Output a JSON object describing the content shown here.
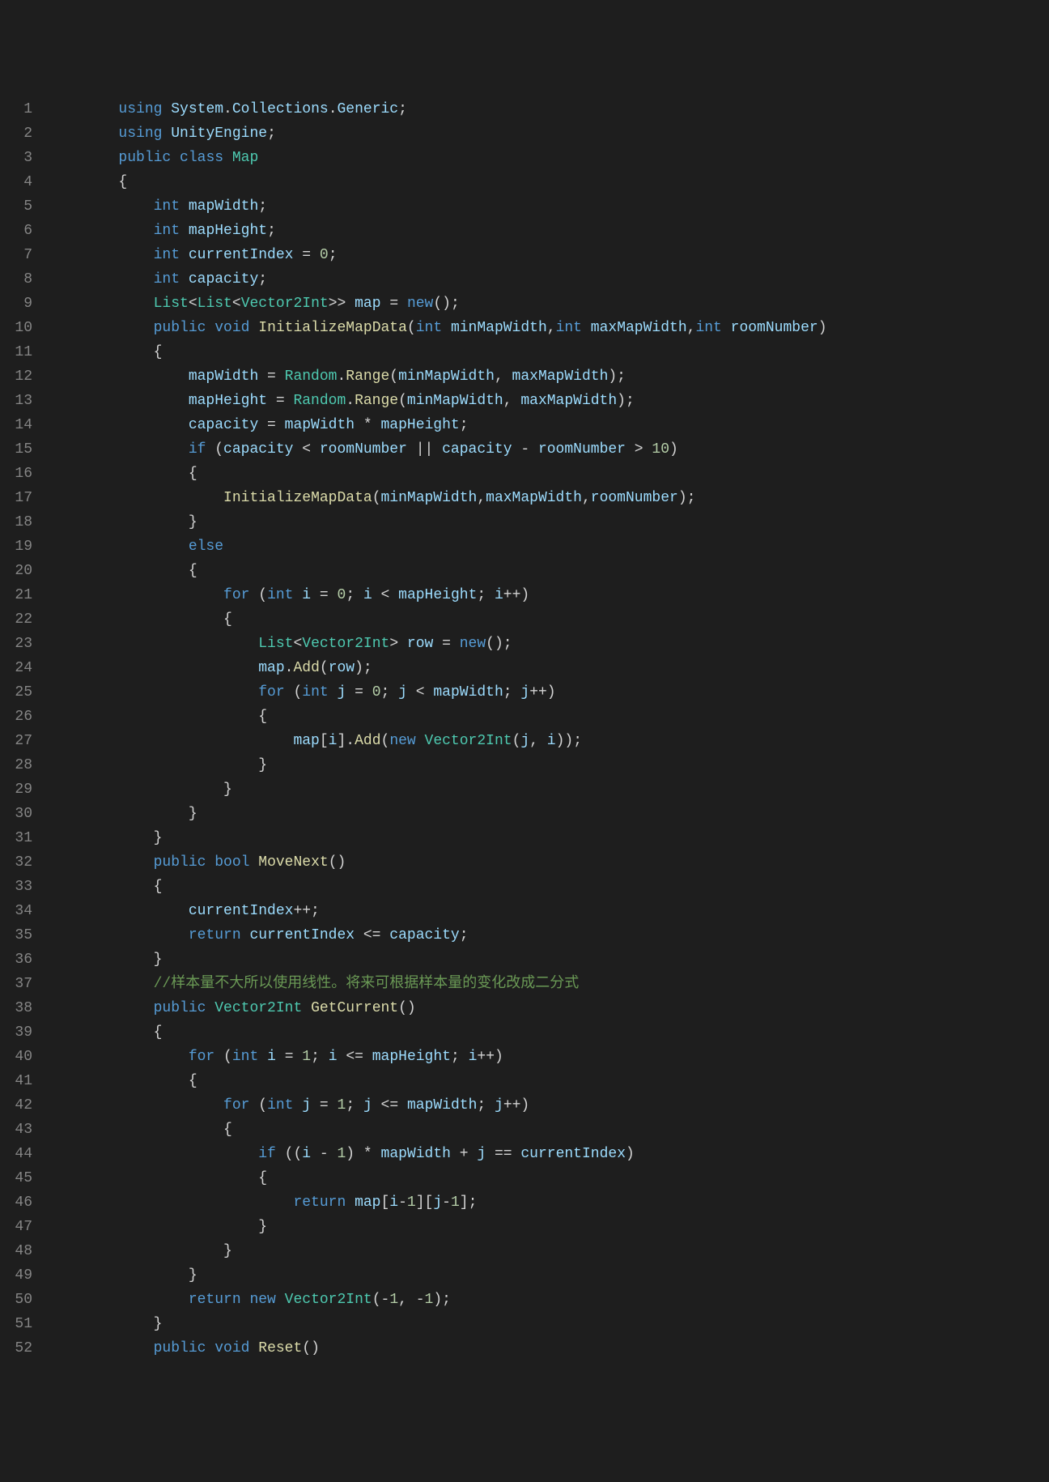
{
  "lines": [
    {
      "n": "1",
      "indent": 2,
      "tokens": [
        {
          "t": "using ",
          "c": "kw"
        },
        {
          "t": "System",
          "c": "var"
        },
        {
          "t": ".",
          "c": "op"
        },
        {
          "t": "Collections",
          "c": "var"
        },
        {
          "t": ".",
          "c": "op"
        },
        {
          "t": "Generic",
          "c": "var"
        },
        {
          "t": ";",
          "c": "op"
        }
      ]
    },
    {
      "n": "2",
      "indent": 2,
      "tokens": [
        {
          "t": "using ",
          "c": "kw"
        },
        {
          "t": "UnityEngine",
          "c": "var"
        },
        {
          "t": ";",
          "c": "op"
        }
      ]
    },
    {
      "n": "3",
      "indent": 2,
      "tokens": [
        {
          "t": "public ",
          "c": "kw"
        },
        {
          "t": "class ",
          "c": "kw"
        },
        {
          "t": "Map",
          "c": "type"
        }
      ]
    },
    {
      "n": "4",
      "indent": 2,
      "tokens": [
        {
          "t": "{",
          "c": "brace"
        }
      ]
    },
    {
      "n": "5",
      "indent": 3,
      "tokens": [
        {
          "t": "int ",
          "c": "kw"
        },
        {
          "t": "mapWidth",
          "c": "var"
        },
        {
          "t": ";",
          "c": "op"
        }
      ]
    },
    {
      "n": "6",
      "indent": 3,
      "tokens": [
        {
          "t": "int ",
          "c": "kw"
        },
        {
          "t": "mapHeight",
          "c": "var"
        },
        {
          "t": ";",
          "c": "op"
        }
      ]
    },
    {
      "n": "7",
      "indent": 3,
      "tokens": [
        {
          "t": "int ",
          "c": "kw"
        },
        {
          "t": "currentIndex",
          "c": "var"
        },
        {
          "t": " = ",
          "c": "op"
        },
        {
          "t": "0",
          "c": "num"
        },
        {
          "t": ";",
          "c": "op"
        }
      ]
    },
    {
      "n": "8",
      "indent": 3,
      "tokens": [
        {
          "t": "int ",
          "c": "kw"
        },
        {
          "t": "capacity",
          "c": "var"
        },
        {
          "t": ";",
          "c": "op"
        }
      ]
    },
    {
      "n": "9",
      "indent": 3,
      "tokens": [
        {
          "t": "List",
          "c": "type"
        },
        {
          "t": "<",
          "c": "op"
        },
        {
          "t": "List",
          "c": "type"
        },
        {
          "t": "<",
          "c": "op"
        },
        {
          "t": "Vector2Int",
          "c": "type"
        },
        {
          "t": ">> ",
          "c": "op"
        },
        {
          "t": "map",
          "c": "var"
        },
        {
          "t": " = ",
          "c": "op"
        },
        {
          "t": "new",
          "c": "kw"
        },
        {
          "t": "();",
          "c": "op"
        }
      ]
    },
    {
      "n": "10",
      "indent": 3,
      "tokens": [
        {
          "t": "public ",
          "c": "kw"
        },
        {
          "t": "void ",
          "c": "kw"
        },
        {
          "t": "InitializeMapData",
          "c": "method"
        },
        {
          "t": "(",
          "c": "op"
        },
        {
          "t": "int ",
          "c": "kw"
        },
        {
          "t": "minMapWidth",
          "c": "var"
        },
        {
          "t": ",",
          "c": "op"
        },
        {
          "t": "int ",
          "c": "kw"
        },
        {
          "t": "maxMapWidth",
          "c": "var"
        },
        {
          "t": ",",
          "c": "op"
        },
        {
          "t": "int ",
          "c": "kw"
        },
        {
          "t": "roomNumber",
          "c": "var"
        },
        {
          "t": ")",
          "c": "op"
        }
      ]
    },
    {
      "n": "11",
      "indent": 3,
      "tokens": [
        {
          "t": "{",
          "c": "brace"
        }
      ]
    },
    {
      "n": "12",
      "indent": 4,
      "tokens": [
        {
          "t": "mapWidth",
          "c": "var"
        },
        {
          "t": " = ",
          "c": "op"
        },
        {
          "t": "Random",
          "c": "type"
        },
        {
          "t": ".",
          "c": "op"
        },
        {
          "t": "Range",
          "c": "method"
        },
        {
          "t": "(",
          "c": "op"
        },
        {
          "t": "minMapWidth",
          "c": "var"
        },
        {
          "t": ", ",
          "c": "op"
        },
        {
          "t": "maxMapWidth",
          "c": "var"
        },
        {
          "t": ");",
          "c": "op"
        }
      ]
    },
    {
      "n": "13",
      "indent": 4,
      "tokens": [
        {
          "t": "mapHeight",
          "c": "var"
        },
        {
          "t": " = ",
          "c": "op"
        },
        {
          "t": "Random",
          "c": "type"
        },
        {
          "t": ".",
          "c": "op"
        },
        {
          "t": "Range",
          "c": "method"
        },
        {
          "t": "(",
          "c": "op"
        },
        {
          "t": "minMapWidth",
          "c": "var"
        },
        {
          "t": ", ",
          "c": "op"
        },
        {
          "t": "maxMapWidth",
          "c": "var"
        },
        {
          "t": ");",
          "c": "op"
        }
      ]
    },
    {
      "n": "14",
      "indent": 4,
      "tokens": [
        {
          "t": "capacity",
          "c": "var"
        },
        {
          "t": " = ",
          "c": "op"
        },
        {
          "t": "mapWidth",
          "c": "var"
        },
        {
          "t": " * ",
          "c": "op"
        },
        {
          "t": "mapHeight",
          "c": "var"
        },
        {
          "t": ";",
          "c": "op"
        }
      ]
    },
    {
      "n": "15",
      "indent": 4,
      "tokens": [
        {
          "t": "if ",
          "c": "kw"
        },
        {
          "t": "(",
          "c": "op"
        },
        {
          "t": "capacity",
          "c": "var"
        },
        {
          "t": " < ",
          "c": "op"
        },
        {
          "t": "roomNumber",
          "c": "var"
        },
        {
          "t": " || ",
          "c": "op"
        },
        {
          "t": "capacity",
          "c": "var"
        },
        {
          "t": " - ",
          "c": "op"
        },
        {
          "t": "roomNumber",
          "c": "var"
        },
        {
          "t": " > ",
          "c": "op"
        },
        {
          "t": "10",
          "c": "num"
        },
        {
          "t": ")",
          "c": "op"
        }
      ]
    },
    {
      "n": "16",
      "indent": 4,
      "tokens": [
        {
          "t": "{",
          "c": "brace"
        }
      ]
    },
    {
      "n": "17",
      "indent": 5,
      "tokens": [
        {
          "t": "InitializeMapData",
          "c": "method"
        },
        {
          "t": "(",
          "c": "op"
        },
        {
          "t": "minMapWidth",
          "c": "var"
        },
        {
          "t": ",",
          "c": "op"
        },
        {
          "t": "maxMapWidth",
          "c": "var"
        },
        {
          "t": ",",
          "c": "op"
        },
        {
          "t": "roomNumber",
          "c": "var"
        },
        {
          "t": ");",
          "c": "op"
        }
      ]
    },
    {
      "n": "18",
      "indent": 4,
      "tokens": [
        {
          "t": "}",
          "c": "brace"
        }
      ]
    },
    {
      "n": "19",
      "indent": 4,
      "tokens": [
        {
          "t": "else",
          "c": "kw"
        }
      ]
    },
    {
      "n": "20",
      "indent": 4,
      "tokens": [
        {
          "t": "{",
          "c": "brace"
        }
      ]
    },
    {
      "n": "21",
      "indent": 5,
      "tokens": [
        {
          "t": "for ",
          "c": "kw"
        },
        {
          "t": "(",
          "c": "op"
        },
        {
          "t": "int ",
          "c": "kw"
        },
        {
          "t": "i",
          "c": "var"
        },
        {
          "t": " = ",
          "c": "op"
        },
        {
          "t": "0",
          "c": "num"
        },
        {
          "t": "; ",
          "c": "op"
        },
        {
          "t": "i",
          "c": "var"
        },
        {
          "t": " < ",
          "c": "op"
        },
        {
          "t": "mapHeight",
          "c": "var"
        },
        {
          "t": "; ",
          "c": "op"
        },
        {
          "t": "i",
          "c": "var"
        },
        {
          "t": "++)",
          "c": "op"
        }
      ]
    },
    {
      "n": "22",
      "indent": 5,
      "tokens": [
        {
          "t": "{",
          "c": "brace"
        }
      ]
    },
    {
      "n": "23",
      "indent": 6,
      "tokens": [
        {
          "t": "List",
          "c": "type"
        },
        {
          "t": "<",
          "c": "op"
        },
        {
          "t": "Vector2Int",
          "c": "type"
        },
        {
          "t": "> ",
          "c": "op"
        },
        {
          "t": "row",
          "c": "var"
        },
        {
          "t": " = ",
          "c": "op"
        },
        {
          "t": "new",
          "c": "kw"
        },
        {
          "t": "();",
          "c": "op"
        }
      ]
    },
    {
      "n": "24",
      "indent": 6,
      "tokens": [
        {
          "t": "map",
          "c": "var"
        },
        {
          "t": ".",
          "c": "op"
        },
        {
          "t": "Add",
          "c": "method"
        },
        {
          "t": "(",
          "c": "op"
        },
        {
          "t": "row",
          "c": "var"
        },
        {
          "t": ");",
          "c": "op"
        }
      ]
    },
    {
      "n": "25",
      "indent": 6,
      "tokens": [
        {
          "t": "for ",
          "c": "kw"
        },
        {
          "t": "(",
          "c": "op"
        },
        {
          "t": "int ",
          "c": "kw"
        },
        {
          "t": "j",
          "c": "var"
        },
        {
          "t": " = ",
          "c": "op"
        },
        {
          "t": "0",
          "c": "num"
        },
        {
          "t": "; ",
          "c": "op"
        },
        {
          "t": "j",
          "c": "var"
        },
        {
          "t": " < ",
          "c": "op"
        },
        {
          "t": "mapWidth",
          "c": "var"
        },
        {
          "t": "; ",
          "c": "op"
        },
        {
          "t": "j",
          "c": "var"
        },
        {
          "t": "++)",
          "c": "op"
        }
      ]
    },
    {
      "n": "26",
      "indent": 6,
      "tokens": [
        {
          "t": "{",
          "c": "brace"
        }
      ]
    },
    {
      "n": "27",
      "indent": 7,
      "tokens": [
        {
          "t": "map",
          "c": "var"
        },
        {
          "t": "[",
          "c": "op"
        },
        {
          "t": "i",
          "c": "var"
        },
        {
          "t": "].",
          "c": "op"
        },
        {
          "t": "Add",
          "c": "method"
        },
        {
          "t": "(",
          "c": "op"
        },
        {
          "t": "new ",
          "c": "kw"
        },
        {
          "t": "Vector2Int",
          "c": "type"
        },
        {
          "t": "(",
          "c": "op"
        },
        {
          "t": "j",
          "c": "var"
        },
        {
          "t": ", ",
          "c": "op"
        },
        {
          "t": "i",
          "c": "var"
        },
        {
          "t": "));",
          "c": "op"
        }
      ]
    },
    {
      "n": "28",
      "indent": 6,
      "tokens": [
        {
          "t": "}",
          "c": "brace"
        }
      ]
    },
    {
      "n": "29",
      "indent": 5,
      "tokens": [
        {
          "t": "}",
          "c": "brace"
        }
      ]
    },
    {
      "n": "30",
      "indent": 4,
      "tokens": [
        {
          "t": "}",
          "c": "brace"
        }
      ]
    },
    {
      "n": "31",
      "indent": 3,
      "tokens": [
        {
          "t": "}",
          "c": "brace"
        }
      ]
    },
    {
      "n": "32",
      "indent": 3,
      "tokens": [
        {
          "t": "public ",
          "c": "kw"
        },
        {
          "t": "bool ",
          "c": "kw"
        },
        {
          "t": "MoveNext",
          "c": "method"
        },
        {
          "t": "()",
          "c": "op"
        }
      ]
    },
    {
      "n": "33",
      "indent": 3,
      "tokens": [
        {
          "t": "{",
          "c": "brace"
        }
      ]
    },
    {
      "n": "34",
      "indent": 4,
      "tokens": [
        {
          "t": "currentIndex",
          "c": "var"
        },
        {
          "t": "++;",
          "c": "op"
        }
      ]
    },
    {
      "n": "35",
      "indent": 4,
      "tokens": [
        {
          "t": "return ",
          "c": "kw"
        },
        {
          "t": "currentIndex",
          "c": "var"
        },
        {
          "t": " <= ",
          "c": "op"
        },
        {
          "t": "capacity",
          "c": "var"
        },
        {
          "t": ";",
          "c": "op"
        }
      ]
    },
    {
      "n": "36",
      "indent": 3,
      "tokens": [
        {
          "t": "}",
          "c": "brace"
        }
      ]
    },
    {
      "n": "37",
      "indent": 3,
      "tokens": [
        {
          "t": "//样本量不大所以使用线性。将来可根据样本量的变化改成二分式",
          "c": "comment"
        }
      ]
    },
    {
      "n": "38",
      "indent": 3,
      "tokens": [
        {
          "t": "public ",
          "c": "kw"
        },
        {
          "t": "Vector2Int ",
          "c": "type"
        },
        {
          "t": "GetCurrent",
          "c": "method"
        },
        {
          "t": "()",
          "c": "op"
        }
      ]
    },
    {
      "n": "39",
      "indent": 3,
      "tokens": [
        {
          "t": "{",
          "c": "brace"
        }
      ]
    },
    {
      "n": "40",
      "indent": 4,
      "tokens": [
        {
          "t": "for ",
          "c": "kw"
        },
        {
          "t": "(",
          "c": "op"
        },
        {
          "t": "int ",
          "c": "kw"
        },
        {
          "t": "i",
          "c": "var"
        },
        {
          "t": " = ",
          "c": "op"
        },
        {
          "t": "1",
          "c": "num"
        },
        {
          "t": "; ",
          "c": "op"
        },
        {
          "t": "i",
          "c": "var"
        },
        {
          "t": " <= ",
          "c": "op"
        },
        {
          "t": "mapHeight",
          "c": "var"
        },
        {
          "t": "; ",
          "c": "op"
        },
        {
          "t": "i",
          "c": "var"
        },
        {
          "t": "++)",
          "c": "op"
        }
      ]
    },
    {
      "n": "41",
      "indent": 4,
      "tokens": [
        {
          "t": "{",
          "c": "brace"
        }
      ]
    },
    {
      "n": "42",
      "indent": 5,
      "tokens": [
        {
          "t": "for ",
          "c": "kw"
        },
        {
          "t": "(",
          "c": "op"
        },
        {
          "t": "int ",
          "c": "kw"
        },
        {
          "t": "j",
          "c": "var"
        },
        {
          "t": " = ",
          "c": "op"
        },
        {
          "t": "1",
          "c": "num"
        },
        {
          "t": "; ",
          "c": "op"
        },
        {
          "t": "j",
          "c": "var"
        },
        {
          "t": " <= ",
          "c": "op"
        },
        {
          "t": "mapWidth",
          "c": "var"
        },
        {
          "t": "; ",
          "c": "op"
        },
        {
          "t": "j",
          "c": "var"
        },
        {
          "t": "++)",
          "c": "op"
        }
      ]
    },
    {
      "n": "43",
      "indent": 5,
      "tokens": [
        {
          "t": "{",
          "c": "brace"
        }
      ]
    },
    {
      "n": "44",
      "indent": 6,
      "tokens": [
        {
          "t": "if ",
          "c": "kw"
        },
        {
          "t": "((",
          "c": "op"
        },
        {
          "t": "i",
          "c": "var"
        },
        {
          "t": " - ",
          "c": "op"
        },
        {
          "t": "1",
          "c": "num"
        },
        {
          "t": ") * ",
          "c": "op"
        },
        {
          "t": "mapWidth",
          "c": "var"
        },
        {
          "t": " + ",
          "c": "op"
        },
        {
          "t": "j",
          "c": "var"
        },
        {
          "t": " == ",
          "c": "op"
        },
        {
          "t": "currentIndex",
          "c": "var"
        },
        {
          "t": ")",
          "c": "op"
        }
      ]
    },
    {
      "n": "45",
      "indent": 6,
      "tokens": [
        {
          "t": "{",
          "c": "brace"
        }
      ]
    },
    {
      "n": "46",
      "indent": 7,
      "tokens": [
        {
          "t": "return ",
          "c": "kw"
        },
        {
          "t": "map",
          "c": "var"
        },
        {
          "t": "[",
          "c": "op"
        },
        {
          "t": "i",
          "c": "var"
        },
        {
          "t": "-",
          "c": "op"
        },
        {
          "t": "1",
          "c": "num"
        },
        {
          "t": "][",
          "c": "op"
        },
        {
          "t": "j",
          "c": "var"
        },
        {
          "t": "-",
          "c": "op"
        },
        {
          "t": "1",
          "c": "num"
        },
        {
          "t": "];",
          "c": "op"
        }
      ]
    },
    {
      "n": "47",
      "indent": 6,
      "tokens": [
        {
          "t": "}",
          "c": "brace"
        }
      ]
    },
    {
      "n": "48",
      "indent": 5,
      "tokens": [
        {
          "t": "}",
          "c": "brace"
        }
      ]
    },
    {
      "n": "49",
      "indent": 4,
      "tokens": [
        {
          "t": "}",
          "c": "brace"
        }
      ]
    },
    {
      "n": "50",
      "indent": 4,
      "tokens": [
        {
          "t": "return ",
          "c": "kw"
        },
        {
          "t": "new ",
          "c": "kw"
        },
        {
          "t": "Vector2Int",
          "c": "type"
        },
        {
          "t": "(-",
          "c": "op"
        },
        {
          "t": "1",
          "c": "num"
        },
        {
          "t": ", -",
          "c": "op"
        },
        {
          "t": "1",
          "c": "num"
        },
        {
          "t": ");",
          "c": "op"
        }
      ]
    },
    {
      "n": "51",
      "indent": 3,
      "tokens": [
        {
          "t": "}",
          "c": "brace"
        }
      ]
    },
    {
      "n": "52",
      "indent": 3,
      "tokens": [
        {
          "t": "public ",
          "c": "kw"
        },
        {
          "t": "void ",
          "c": "kw"
        },
        {
          "t": "Reset",
          "c": "method"
        },
        {
          "t": "()",
          "c": "op"
        }
      ]
    }
  ]
}
